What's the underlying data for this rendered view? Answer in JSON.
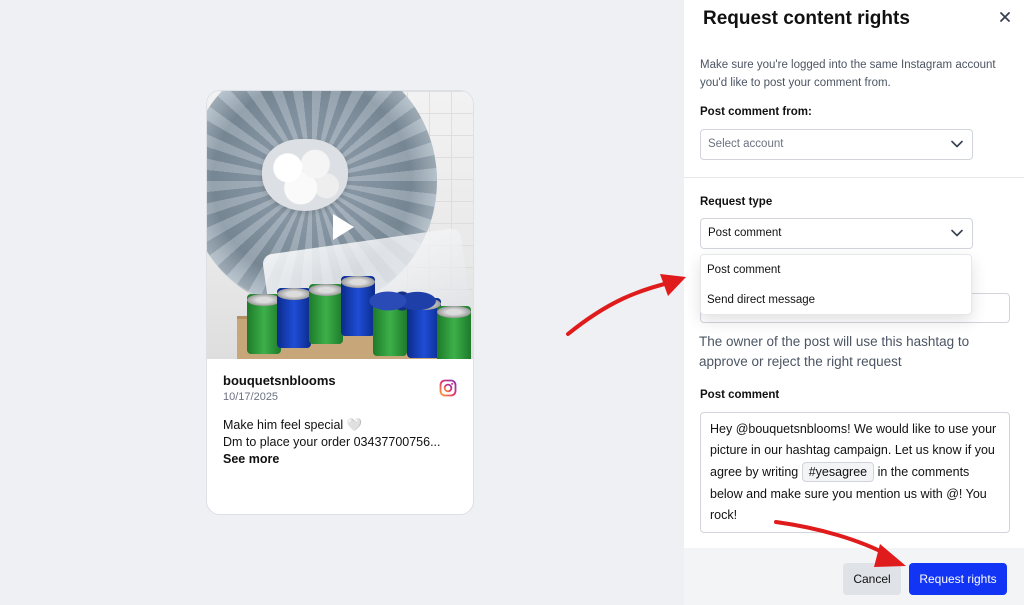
{
  "post": {
    "username": "bouquetsnblooms",
    "date": "10/17/2025",
    "caption_line1": "Make him feel special 🤍",
    "caption_line2": "Dm to place your order 03437700756...",
    "see_more": "See more",
    "platform_icon": "instagram-icon"
  },
  "panel": {
    "title": "Request content rights",
    "intro": "Make sure you're logged into the same Instagram account you'd like to post your comment from.",
    "post_from_label": "Post comment from:",
    "account_placeholder": "Select account",
    "request_type_label": "Request type",
    "request_type_value": "Post comment",
    "request_type_options": [
      "Post comment",
      "Send direct message"
    ],
    "hashtag_hint": "The owner of the post will use this hashtag to approve or reject the right request",
    "post_comment_label": "Post comment",
    "comment_part1": "Hey @bouquetsnblooms! We would like to use your picture in our hashtag campaign. Let us know if you agree by writing",
    "comment_hashtag": "#yesagree",
    "comment_part2": "in the comments below and make sure you mention us with @! You rock!",
    "cancel_label": "Cancel",
    "submit_label": "Request rights"
  },
  "colors": {
    "primary": "#1234f5",
    "annotation_arrow": "#e01b1b",
    "backdrop": "#eef0f4"
  }
}
